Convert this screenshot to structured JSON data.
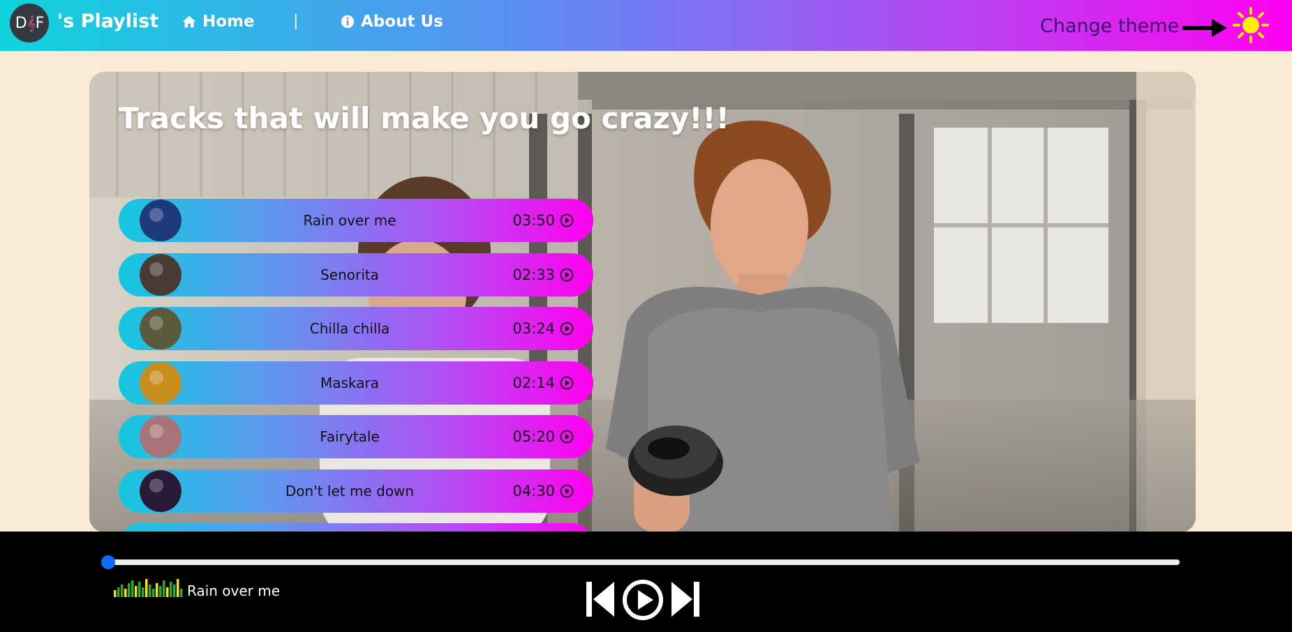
{
  "navbar": {
    "logo_text_left": "D",
    "logo_text_right": "F",
    "brand": "'s Playlist",
    "home_label": "Home",
    "separator": "|",
    "about_label": "About Us",
    "theme_label": "Change theme"
  },
  "hero": {
    "title": "Tracks that will make you go crazy!!!"
  },
  "tracks": [
    {
      "title": "Rain over me",
      "duration": "03:50",
      "art_color": "#1d3a7a"
    },
    {
      "title": "Senorita",
      "duration": "02:33",
      "art_color": "#4a3a34"
    },
    {
      "title": "Chilla chilla",
      "duration": "03:24",
      "art_color": "#5c5a3c"
    },
    {
      "title": "Maskara",
      "duration": "02:14",
      "art_color": "#c98d1e"
    },
    {
      "title": "Fairytale",
      "duration": "05:20",
      "art_color": "#a8747a"
    },
    {
      "title": "Don't let me down",
      "duration": "04:30",
      "art_color": "#2a1a3a"
    }
  ],
  "player": {
    "now_playing": "Rain over me",
    "progress": 0
  },
  "colors": {
    "accent": "#0d6efd",
    "nav_gradient_start": "#0fd3dd",
    "nav_gradient_end": "#ff00f2",
    "page_bg": "#faebd7",
    "sun": "#ffee00"
  }
}
